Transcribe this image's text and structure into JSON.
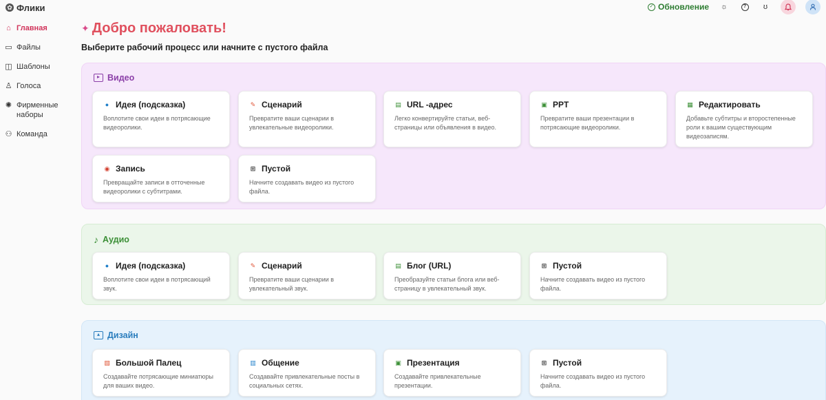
{
  "app": {
    "name": "Флики"
  },
  "header": {
    "update_label": "Обновление",
    "icons": [
      "theme-sun-icon",
      "help-icon",
      "streak-icon",
      "notifications-icon",
      "account-icon"
    ]
  },
  "sidebar": {
    "items": [
      {
        "label": "Главная",
        "icon": "home-icon",
        "active": true
      },
      {
        "label": "Файлы",
        "icon": "folder-icon"
      },
      {
        "label": "Шаблоны",
        "icon": "template-icon"
      },
      {
        "label": "Голоса",
        "icon": "microphone-icon"
      },
      {
        "label": "Фирменные наборы",
        "icon": "palette-icon"
      },
      {
        "label": "Команда",
        "icon": "team-icon"
      }
    ]
  },
  "main": {
    "welcome": "Добро пожаловать!",
    "subtitle": "Выберите рабочий процесс или начните с пустого файла"
  },
  "sections": {
    "video": {
      "title": "Видео",
      "color": "#8b3fa8",
      "cards": [
        {
          "title": "Идея (подсказка)",
          "desc": "Воплотите свои идеи в потрясающие видеоролики.",
          "icon": "lightbulb-icon"
        },
        {
          "title": "Сценарий",
          "desc": "Превратите ваши сценарии в увлекательные видеоролики.",
          "icon": "script-icon"
        },
        {
          "title": "URL -адрес",
          "desc": "Легко конвертируйте статьи, веб-страницы или объявления в видео.",
          "icon": "document-icon"
        },
        {
          "title": "PPT",
          "desc": "Превратите ваши презентации в потрясающие видеоролики.",
          "icon": "ppt-icon"
        },
        {
          "title": "Редактировать",
          "desc": "Добавьте субтитры и второстепенные роли к вашим существующим видеозаписям.",
          "icon": "clapperboard-icon"
        },
        {
          "title": "Запись",
          "desc": "Превращайте записи в отточенные видеоролики с субтитрами.",
          "icon": "record-icon"
        },
        {
          "title": "Пустой",
          "desc": "Начните создавать видео из пустого файла.",
          "icon": "plus-square-icon"
        }
      ]
    },
    "audio": {
      "title": "Аудио",
      "color": "#3b8f36",
      "cards": [
        {
          "title": "Идея (подсказка)",
          "desc": "Воплотите свои идеи в потрясающий звук.",
          "icon": "lightbulb-icon"
        },
        {
          "title": "Сценарий",
          "desc": "Превратите ваши сценарии в увлекательный звук.",
          "icon": "script-icon"
        },
        {
          "title": "Блог (URL)",
          "desc": "Преобразуйте статьи блога или веб-страницу в увлекательный звук.",
          "icon": "document-icon"
        },
        {
          "title": "Пустой",
          "desc": "Начните создавать видео из пустого файла.",
          "icon": "plus-square-icon"
        }
      ]
    },
    "design": {
      "title": "Дизайн",
      "color": "#2a7dbd",
      "cards": [
        {
          "title": "Большой Палец",
          "desc": "Создавайте потрясающие миниатюры для ваших видео.",
          "icon": "image-icon"
        },
        {
          "title": "Общение",
          "desc": "Создавайте привлекательные посты в социальных сетях.",
          "icon": "social-icon"
        },
        {
          "title": "Презентация",
          "desc": "Создавайте привлекательные презентации.",
          "icon": "slides-icon"
        },
        {
          "title": "Пустой",
          "desc": "Начните создавать видео из пустого файла.",
          "icon": "plus-square-icon"
        }
      ]
    }
  }
}
